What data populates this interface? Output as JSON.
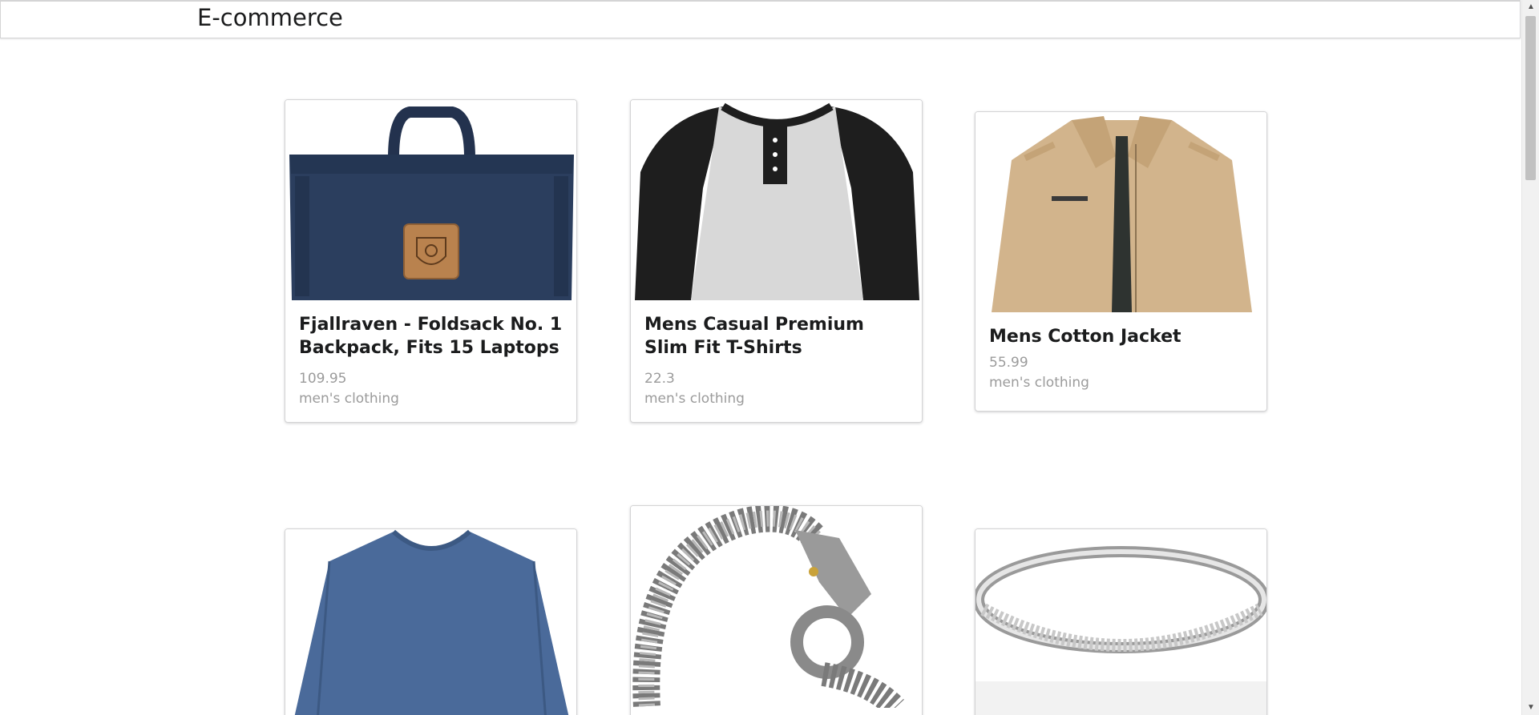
{
  "header": {
    "brand": "E-commerce"
  },
  "products": [
    {
      "title": "Fjallraven - Foldsack No. 1 Backpack, Fits 15 Laptops",
      "price": "109.95",
      "category": "men's clothing",
      "icon": "backpack-image"
    },
    {
      "title": "Mens Casual Premium Slim Fit T-Shirts",
      "price": "22.3",
      "category": "men's clothing",
      "icon": "tshirt-image"
    },
    {
      "title": "Mens Cotton Jacket",
      "price": "55.99",
      "category": "men's clothing",
      "icon": "jacket-image"
    },
    {
      "title": "",
      "price": "",
      "category": "",
      "icon": "long-sleeve-shirt-image"
    },
    {
      "title": "",
      "price": "",
      "category": "",
      "icon": "dragon-bracelet-image"
    },
    {
      "title": "",
      "price": "",
      "category": "",
      "icon": "ring-image"
    }
  ],
  "colors": {
    "border": "#d4d4d5",
    "title": "#1b1c1d",
    "meta": "#9b9b9b",
    "backpack": "#2b3e5e",
    "jacket": "#d2b48c",
    "shirt_blue": "#4a6a9a"
  },
  "scrollbar": {
    "up_icon": "scroll-up-arrow",
    "down_icon": "scroll-down-arrow"
  }
}
